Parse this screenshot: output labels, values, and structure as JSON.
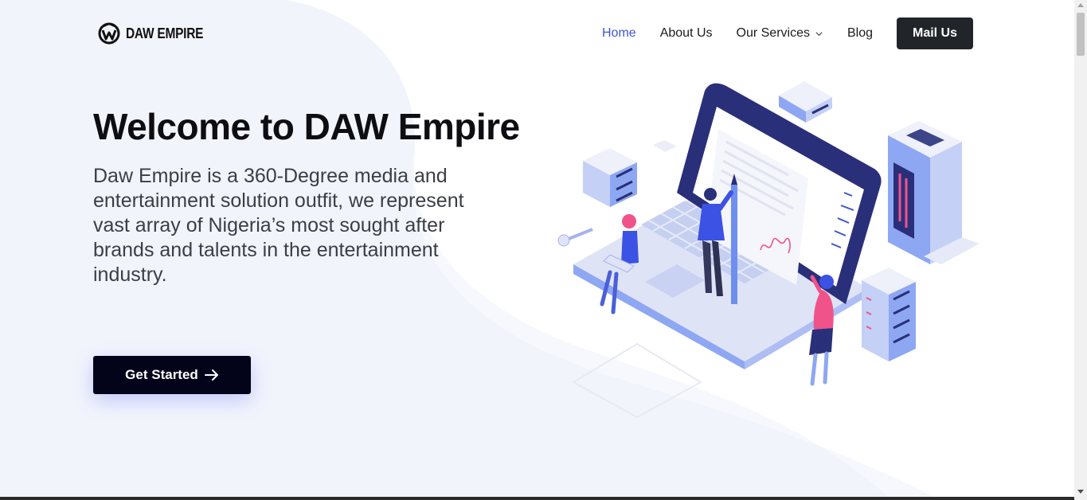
{
  "brand": {
    "name": "DAW EMPIRE"
  },
  "nav": {
    "items": [
      {
        "label": "Home",
        "active": true
      },
      {
        "label": "About Us"
      },
      {
        "label": "Our Services",
        "has_dropdown": true
      },
      {
        "label": "Blog"
      }
    ],
    "mail_button": "Mail Us"
  },
  "hero": {
    "title": "Welcome to DAW Empire",
    "description": "Daw Empire is a 360-Degree media and entertainment solution outfit, we represent vast array of Nigeria’s most sought after brands and talents in the entertainment industry.",
    "cta": "Get Started"
  },
  "colors": {
    "accent": "#4154d8",
    "dark": "#212429",
    "cta": "#03041a",
    "background_wave": "#f2f4fc",
    "illustration_navy": "#2a2f7a",
    "illustration_blue": "#3b52e4",
    "illustration_pink": "#f0538a"
  },
  "icons": {
    "logo": "daw-empire-logo-icon",
    "dropdown": "chevron-down-icon",
    "cta_arrow": "arrow-right-icon"
  }
}
